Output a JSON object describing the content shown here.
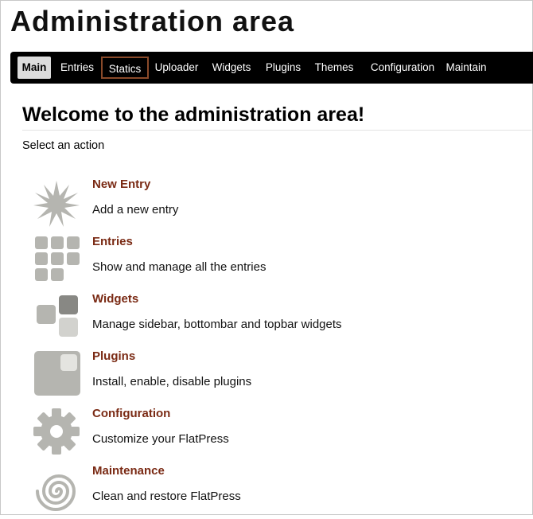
{
  "page": {
    "title": "Administration area"
  },
  "nav": {
    "items": [
      {
        "label": "Main",
        "state": "active"
      },
      {
        "label": "Entries"
      },
      {
        "label": "Statics",
        "state": "hover"
      },
      {
        "label": "Uploader"
      },
      {
        "label": "Widgets"
      },
      {
        "label": "Plugins"
      },
      {
        "label": "Themes"
      },
      {
        "label": "Configuration"
      },
      {
        "label": "Maintain"
      }
    ]
  },
  "main": {
    "heading": "Welcome to the administration area!",
    "subtitle": "Select an action",
    "actions": [
      {
        "title": "New Entry",
        "description": "Add a new entry",
        "icon": "star-burst-icon"
      },
      {
        "title": "Entries",
        "description": "Show and manage all the entries",
        "icon": "grid-icon"
      },
      {
        "title": "Widgets",
        "description": "Manage sidebar, bottombar and topbar widgets",
        "icon": "widgets-icon"
      },
      {
        "title": "Plugins",
        "description": "Install, enable, disable plugins",
        "icon": "plugin-icon"
      },
      {
        "title": "Configuration",
        "description": "Customize your FlatPress",
        "icon": "gear-icon"
      },
      {
        "title": "Maintenance",
        "description": "Clean and restore FlatPress",
        "icon": "spiral-icon"
      }
    ]
  },
  "colors": {
    "nav_background": "#000000",
    "link": "#7a2a14",
    "icon_gray": "#b5b5b0"
  }
}
